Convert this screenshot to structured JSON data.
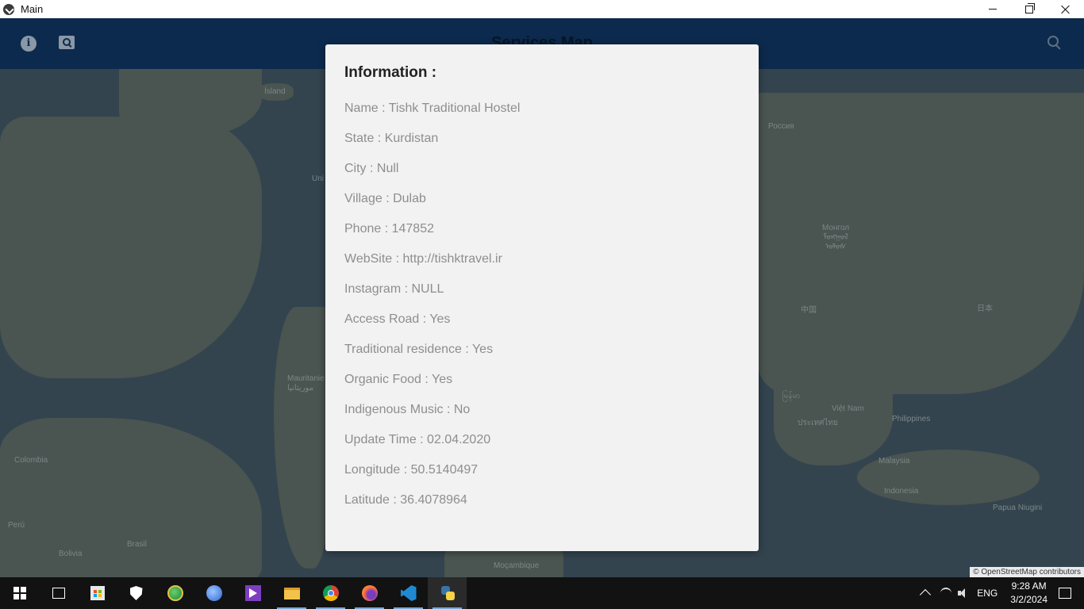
{
  "window": {
    "title": "Main"
  },
  "appbar": {
    "title": "Services Map"
  },
  "map": {
    "labels": {
      "island": "Ísland",
      "russia": "Россия",
      "mongolia": "Монгол\nᠮᠣᠩᠭᠣᠯ\nᠤᠯᠤᠰ",
      "china": "中国",
      "japan": "日本",
      "myanmar": "မြန်မာ",
      "thailand": "ประเทศไทย",
      "vietnam": "Việt Nam",
      "philippines": "Philippines",
      "malaysia": "Malaysia",
      "indonesia": "Indonesia",
      "papua": "Papua Niugini",
      "mauritania": "Mauritanie\nموريتانيا",
      "colombia": "Colombia",
      "peru": "Perú",
      "bolivia": "Bolivia",
      "brasil": "Brasil",
      "mozambique": "Moçambique",
      "uni": "Uni"
    },
    "attribution": "© OpenStreetMap contributors"
  },
  "dialog": {
    "title": "Information :",
    "rows": [
      "Name : Tishk Traditional Hostel",
      "State : Kurdistan",
      "City : Null",
      "Village : Dulab",
      "Phone : 147852",
      "WebSite : http://tishktravel.ir",
      "Instagram : NULL",
      "Access Road : Yes",
      "Traditional residence : Yes",
      "Organic Food : Yes",
      "Indigenous Music : No",
      "Update Time : 02.04.2020",
      "Longitude : 50.5140497",
      "Latitude : 36.4078964"
    ]
  },
  "taskbar": {
    "language": "ENG",
    "time": "9:28 AM",
    "date": "3/2/2024"
  }
}
